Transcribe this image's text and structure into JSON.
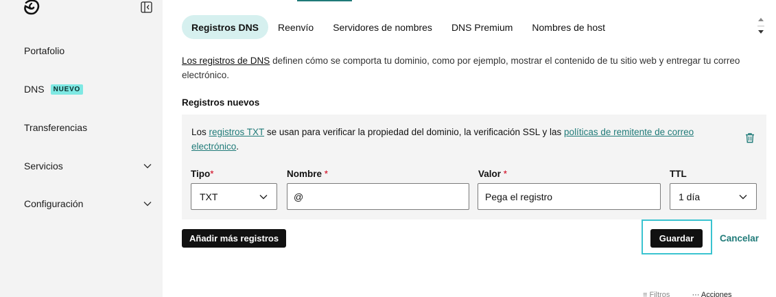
{
  "sidebar": {
    "items": [
      {
        "label": "Portafolio"
      },
      {
        "label": "DNS",
        "badge": "NUEVO"
      },
      {
        "label": "Transferencias"
      },
      {
        "label": "Servicios"
      },
      {
        "label": "Configuración"
      }
    ]
  },
  "tabs": [
    {
      "label": "Registros DNS",
      "active": true
    },
    {
      "label": "Reenvío"
    },
    {
      "label": "Servidores de nombres"
    },
    {
      "label": "DNS Premium"
    },
    {
      "label": "Nombres de host"
    }
  ],
  "intro": {
    "link": "Los registros de DNS",
    "text": " definen cómo se comporta tu dominio, como por ejemplo, mostrar el contenido de tu sitio web y entregar tu correo electrónico."
  },
  "section_title": "Registros nuevos",
  "record": {
    "info_pre": "Los ",
    "info_link1": "registros TXT",
    "info_mid": " se usan para verificar la propiedad del dominio, la verificación SSL y las ",
    "info_link2": "políticas de remitente de correo electrónico",
    "info_post": ".",
    "fields": {
      "tipo": {
        "label": "Tipo",
        "required": "*",
        "value": "TXT"
      },
      "nombre": {
        "label": "Nombre ",
        "required": "*",
        "value": "@"
      },
      "valor": {
        "label": "Valor ",
        "required": "*",
        "placeholder": "Pega el registro"
      },
      "ttl": {
        "label": "TTL",
        "value": "1 día"
      }
    }
  },
  "buttons": {
    "add": "Añadir más registros",
    "save": "Guardar",
    "cancel": "Cancelar"
  },
  "bottom": {
    "filters": "Filtros",
    "actions": "Acciones"
  },
  "colors": {
    "accent": "#1f7a78",
    "badge": "#7ee8e3",
    "highlight": "#39c3d0"
  }
}
